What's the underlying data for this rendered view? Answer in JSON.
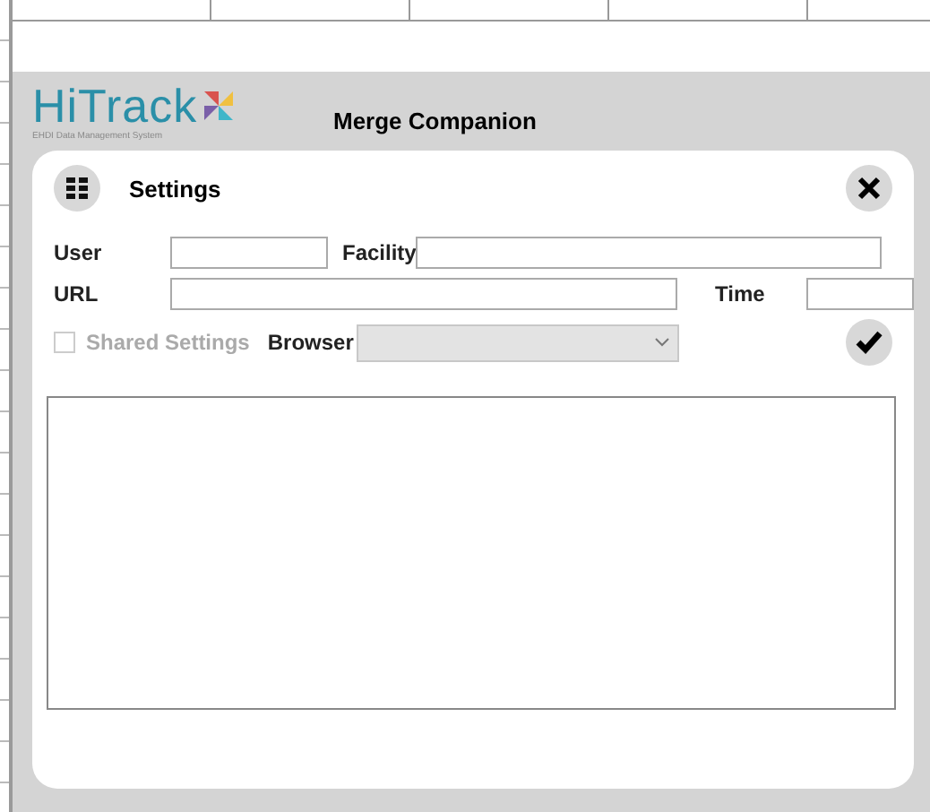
{
  "app": {
    "logo": "HiTrack",
    "logo_tagline": "EHDI Data Management System",
    "title": "Merge Companion"
  },
  "dialog": {
    "title": "Settings",
    "fields": [
      {
        "label": "User"
      },
      {
        "label": "Facility"
      },
      {
        "label": "URL"
      },
      {
        "label": "Time"
      }
    ],
    "shared_settings": {
      "label": "Shared Settings",
      "checked": false,
      "disabled": true
    },
    "browser": {
      "label": "Browser"
    }
  }
}
